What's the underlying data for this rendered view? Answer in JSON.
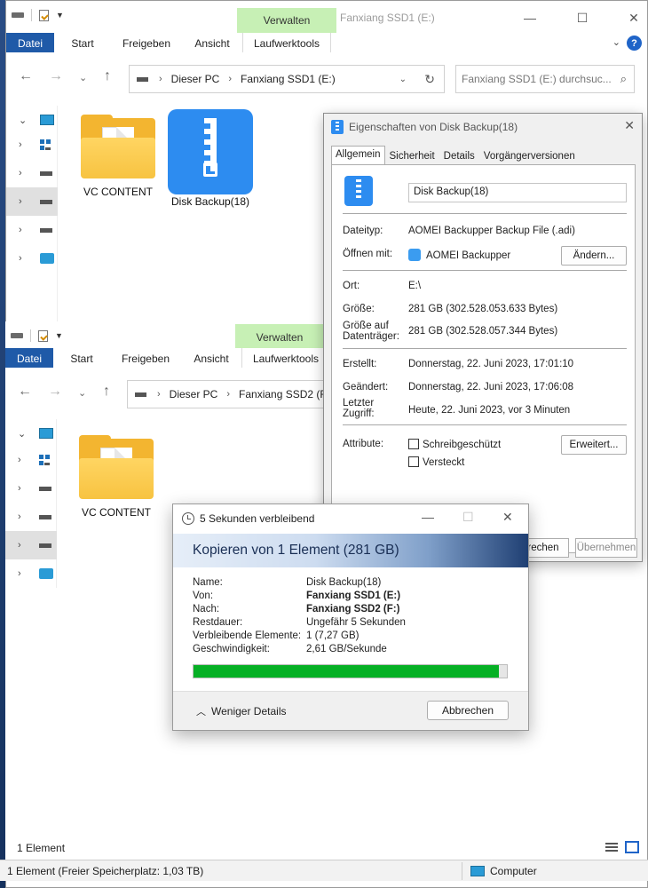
{
  "window1": {
    "title": "Fanxiang SSD1 (E:)",
    "manage_tab": "Verwalten",
    "ribbon": {
      "file": "Datei",
      "tabs": [
        "Start",
        "Freigeben",
        "Ansicht",
        "Laufwerktools"
      ]
    },
    "breadcrumb": [
      "Dieser PC",
      "Fanxiang SSD1 (E:)"
    ],
    "search_placeholder": "Fanxiang SSD1 (E:) durchsuc...",
    "items": [
      {
        "label": "VC CONTENT",
        "icon": "folder-icon"
      },
      {
        "label": "Disk Backup(18)",
        "icon": "zip-archive-icon"
      }
    ]
  },
  "window2": {
    "manage_tab": "Verwalten",
    "ribbon": {
      "file": "Datei",
      "tabs": [
        "Start",
        "Freigeben",
        "Ansicht",
        "Laufwerktools"
      ]
    },
    "breadcrumb": [
      "Dieser PC",
      "Fanxiang SSD2 (F:)"
    ],
    "items": [
      {
        "label": "VC CONTENT",
        "icon": "folder-icon"
      }
    ],
    "status_count": "1 Element"
  },
  "status_bar": {
    "text": "1 Element (Freier Speicherplatz: 1,03 TB)",
    "computer": "Computer"
  },
  "properties": {
    "title": "Eigenschaften von Disk Backup(18)",
    "tabs": [
      "Allgemein",
      "Sicherheit",
      "Details",
      "Vorgängerversionen"
    ],
    "name": "Disk Backup(18)",
    "rows": {
      "type_label": "Dateityp:",
      "type_value": "AOMEI Backupper Backup File (.adi)",
      "opens_label": "Öffnen mit:",
      "opens_value": "AOMEI Backupper",
      "change_btn": "Ändern...",
      "location_label": "Ort:",
      "location_value": "E:\\",
      "size_label": "Größe:",
      "size_value": "281 GB (302.528.053.633 Bytes)",
      "size_disk_label": "Größe auf Datenträger:",
      "size_disk_value": "281 GB (302.528.057.344 Bytes)",
      "created_label": "Erstellt:",
      "created_value": "Donnerstag, 22. Juni 2023, 17:01:10",
      "modified_label": "Geändert:",
      "modified_value": "Donnerstag, 22. Juni 2023, 17:06:08",
      "accessed_label": "Letzter Zugriff:",
      "accessed_value": "Heute, 22. Juni 2023, vor 3 Minuten",
      "attr_label": "Attribute:",
      "readonly": "Schreibgeschützt",
      "hidden": "Versteckt",
      "advanced_btn": "Erweitert..."
    },
    "bottom_buttons": [
      "rechen",
      "Übernehmen"
    ]
  },
  "copy_dialog": {
    "title": "5 Sekunden verbleibend",
    "header": "Kopieren von 1 Element (281 GB)",
    "rows": [
      {
        "label": "Name:",
        "value": "Disk Backup(18)"
      },
      {
        "label": "Von:",
        "value": "Fanxiang SSD1 (E:)"
      },
      {
        "label": "Nach:",
        "value": "Fanxiang SSD2 (F:)"
      },
      {
        "label": "Restdauer:",
        "value": "Ungefähr 5 Sekunden"
      },
      {
        "label": "Verbleibende Elemente:",
        "value": "1 (7,27 GB)"
      },
      {
        "label": "Geschwindigkeit:",
        "value": "2,61 GB/Sekunde"
      }
    ],
    "progress": 0.975,
    "less_details": "Weniger Details",
    "cancel": "Abbrechen"
  }
}
